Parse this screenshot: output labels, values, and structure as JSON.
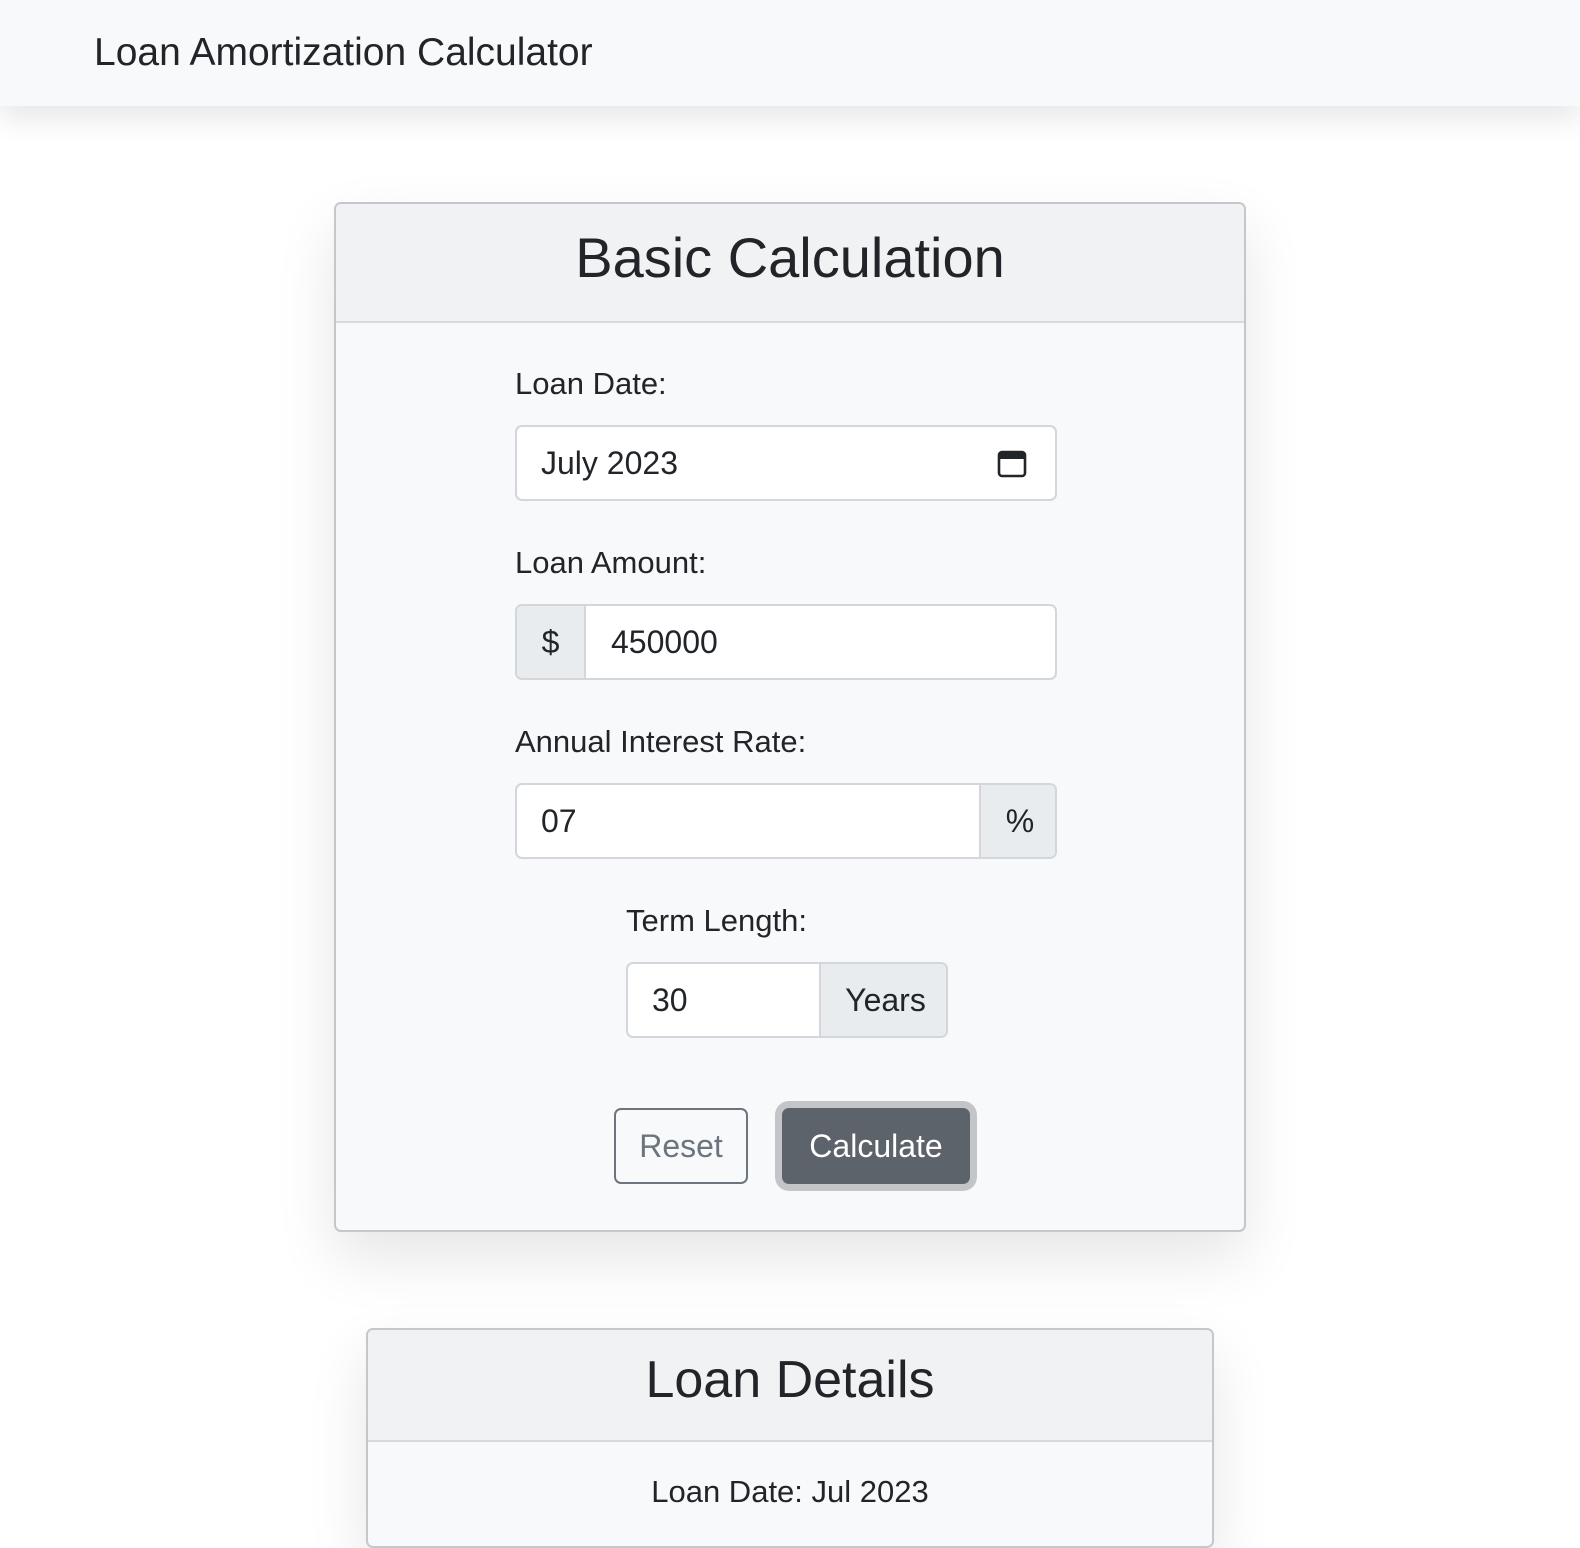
{
  "navbar": {
    "brand": "Loan Amortization Calculator"
  },
  "basic_calculation": {
    "title": "Basic Calculation",
    "loan_date": {
      "label": "Loan Date:",
      "value": "July 2023",
      "icon": "calendar-icon"
    },
    "loan_amount": {
      "label": "Loan Amount:",
      "prefix": "$",
      "value": "450000"
    },
    "interest_rate": {
      "label": "Annual Interest Rate:",
      "value": "07",
      "suffix": "%"
    },
    "term_length": {
      "label": "Term Length:",
      "value": "30",
      "suffix": "Years"
    },
    "buttons": {
      "reset": "Reset",
      "calculate": "Calculate"
    }
  },
  "loan_details": {
    "title": "Loan Details",
    "loan_date_label": "Loan Date:",
    "loan_date_value": "Jul 2023"
  },
  "colors": {
    "navbar_bg": "#f8f9fa",
    "card_bg": "#f8f9fa",
    "addon_bg": "#e9ecef",
    "primary_button": "#5c636a",
    "outline_button": "#6c757d"
  }
}
